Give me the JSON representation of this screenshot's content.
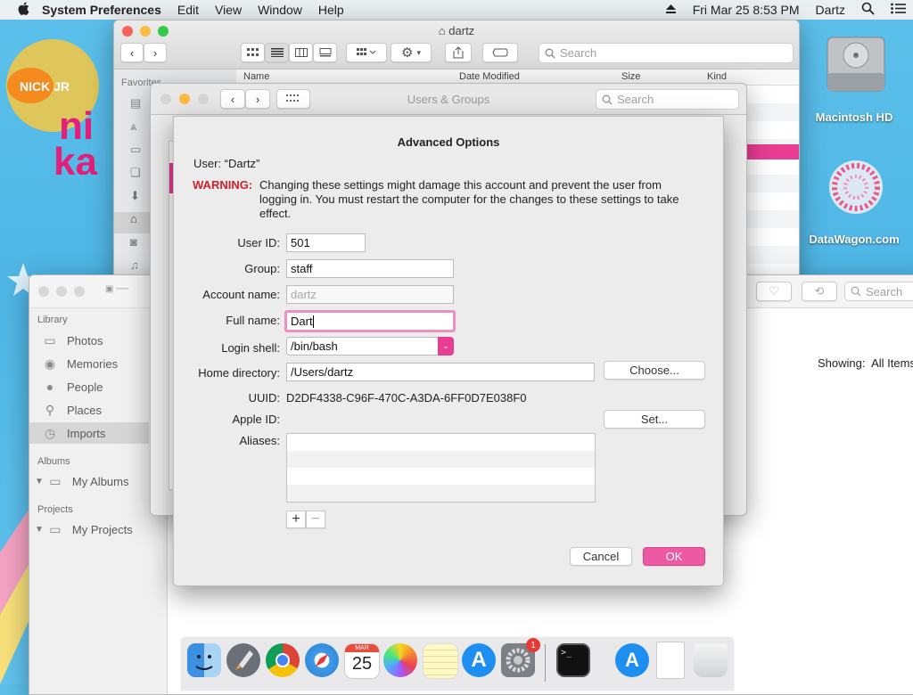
{
  "menubar": {
    "apple": "",
    "app_name": "System Preferences",
    "items": [
      "Edit",
      "View",
      "Window",
      "Help"
    ],
    "datetime": "Fri Mar 25  8:53 PM",
    "user": "Dartz"
  },
  "desktop": {
    "icons": [
      {
        "label": "Macintosh HD"
      },
      {
        "label": "DataWagon.com"
      }
    ]
  },
  "finder": {
    "title": "dartz",
    "search_placeholder": "Search",
    "sidebar_heading": "Favorites",
    "columns": [
      "Name",
      "Date Modified",
      "Size",
      "Kind"
    ]
  },
  "photos": {
    "search_placeholder": "Search",
    "showing_label": "Showing:",
    "showing_value": "All Items",
    "sections": [
      {
        "heading": "Library",
        "items": [
          "Photos",
          "Memories",
          "People",
          "Places",
          "Imports"
        ]
      },
      {
        "heading": "Albums",
        "items": [
          "My Albums"
        ]
      },
      {
        "heading": "Projects",
        "items": [
          "My Projects"
        ]
      }
    ],
    "selected_item": "Imports"
  },
  "users_groups": {
    "title": "Users & Groups",
    "search_placeholder": "Search"
  },
  "dialog": {
    "title": "Advanced Options",
    "user_line": "User:  “Dartz”",
    "warning_label": "WARNING:",
    "warning_text": "Changing these settings might damage this account and prevent the user from logging in. You must restart the computer for the changes to these settings to take effect.",
    "fields": {
      "user_id": {
        "label": "User ID:",
        "value": "501"
      },
      "group": {
        "label": "Group:",
        "value": "staff"
      },
      "account_name": {
        "label": "Account name:",
        "value": "dartz"
      },
      "full_name": {
        "label": "Full name:",
        "value": "Dart"
      },
      "login_shell": {
        "label": "Login shell:",
        "value": "/bin/bash"
      },
      "home_directory": {
        "label": "Home directory:",
        "value": "/Users/dartz"
      },
      "uuid": {
        "label": "UUID:",
        "value": "D2DF4338-C96F-470C-A3DA-6FF0D7E038F0"
      },
      "apple_id": {
        "label": "Apple ID:",
        "value": ""
      },
      "aliases": {
        "label": "Aliases:"
      }
    },
    "choose_button": "Choose...",
    "set_button": "Set...",
    "add_button": "+",
    "remove_button": "−",
    "cancel_button": "Cancel",
    "ok_button": "OK"
  },
  "dock": {
    "apps": [
      "Finder",
      "Launchpad",
      "Chrome",
      "Safari",
      "Calendar",
      "Photos",
      "Notes",
      "App Store",
      "System Preferences",
      "Terminal",
      "App Store Downloads",
      "Document",
      "Trash"
    ],
    "calendar_month": "MAR",
    "calendar_day": "25",
    "badge": "1"
  },
  "colors": {
    "accent": "#e93d92",
    "warning": "#d0202b",
    "desktop": "#5cc0ea"
  }
}
